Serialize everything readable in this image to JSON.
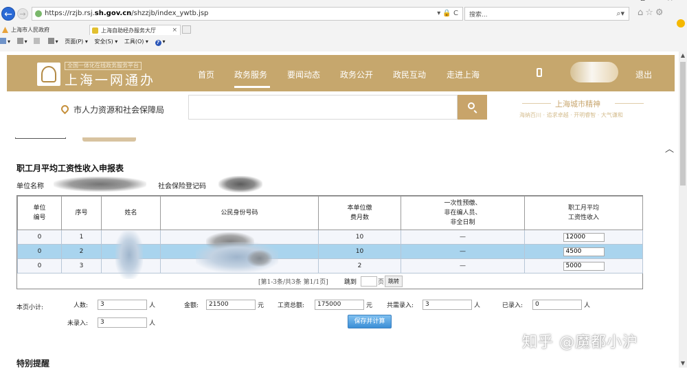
{
  "browser": {
    "url_prefix": "https://rzjb.rsj.",
    "url_domain": "sh.gov.cn",
    "url_path": "/shzzjb/index_ywtb.jsp",
    "url_tools": "▾ 🔒 C",
    "search_placeholder": "搜索...",
    "tabs": [
      {
        "label": "上海市人民政府"
      },
      {
        "label": "上海自助经办服务大厅",
        "close": "×"
      }
    ],
    "commands": {
      "page": "页面(P) ▾",
      "safety": "安全(S) ▾",
      "tools": "工具(O) ▾"
    },
    "window_controls": "– ▫ ×"
  },
  "site": {
    "brand_subtitle": "全国一体化在线政务服务平台",
    "brand_name": "上海一网通办",
    "nav": [
      "首页",
      "政务服务",
      "要闻动态",
      "政务公开",
      "政民互动",
      "走进上海"
    ],
    "active_nav_index": 1,
    "logout": "退出",
    "department": "市人力资源和社会保障局",
    "spirit_title": "上海城市精神",
    "spirit_subtitle": "海纳百川 · 追求卓越 · 开明睿智 · 大气谦和"
  },
  "form": {
    "title": "职工月平均工资性收入申报表",
    "unit_name_label": "单位名称",
    "social_security_label": "社会保险登记码",
    "columns": [
      "单位\n编号",
      "序号",
      "姓名",
      "公民身份号码",
      "本单位缴\n费月数",
      "一次性预缴、\n非在编人员、\n非全日制",
      "职工月平均\n工资性收入"
    ],
    "rows": [
      {
        "unit_no": "0",
        "seq": "1",
        "months": "10",
        "flag": "—",
        "income": "12000"
      },
      {
        "unit_no": "0",
        "seq": "2",
        "months": "10",
        "flag": "—",
        "income": "4500"
      },
      {
        "unit_no": "0",
        "seq": "3",
        "months": "2",
        "flag": "—",
        "income": "5000"
      }
    ],
    "pager": {
      "text": "[第1-3条/共3条 第1/1页]",
      "jump": "跳到",
      "page": "页",
      "go": "跳转"
    },
    "summary": {
      "label": "本页小计:",
      "people_label": "人数:",
      "people": "3",
      "people_unit": "人",
      "amount_label": "金额:",
      "amount": "21500",
      "amount_unit": "元",
      "wage_total_label": "工资总额:",
      "wage_total": "175000",
      "wage_total_unit": "元",
      "need_label": "共需录入:",
      "need": "3",
      "need_unit": "人",
      "entered_label": "已录入:",
      "entered": "0",
      "entered_unit": "人",
      "not_entered_label": "未录入:",
      "not_entered": "3",
      "not_entered_unit": "人"
    },
    "save_button": "保存并计算",
    "notice_title": "特别提醒"
  },
  "watermark": "知乎 @魔都小沪"
}
